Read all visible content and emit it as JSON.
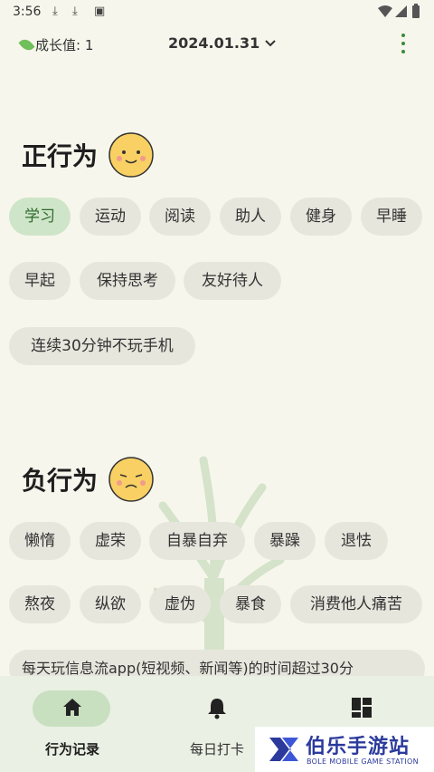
{
  "status": {
    "time": "3:56"
  },
  "header": {
    "growth_label": "成长值: 1",
    "date": "2024.01.31"
  },
  "positive": {
    "title": "正行为",
    "chips": [
      "学习",
      "运动",
      "阅读",
      "助人",
      "健身",
      "早睡",
      "早起",
      "保持思考",
      "友好待人",
      "连续30分钟不玩手机"
    ]
  },
  "negative": {
    "title": "负行为",
    "chips": [
      "懒惰",
      "虚荣",
      "自暴自弃",
      "暴躁",
      "退怯",
      "熬夜",
      "纵欲",
      "虚伪",
      "暴食",
      "消费他人痛苦",
      "每天玩信息流app(短视频、新闻等)的时间超过30分"
    ]
  },
  "nav": {
    "tab1": "行为记录",
    "tab2": "每日打卡"
  },
  "watermark": {
    "title": "伯乐手游站",
    "subtitle": "BOLE MOBILE GAME STATION"
  },
  "colors": {
    "accent": "#3a8a3a",
    "active_chip": "#cfe5c9",
    "chip": "#e7e6dd",
    "background": "#f7f6ec",
    "nav_bg": "#eaf0e3",
    "watermark": "#2b3a9c"
  }
}
